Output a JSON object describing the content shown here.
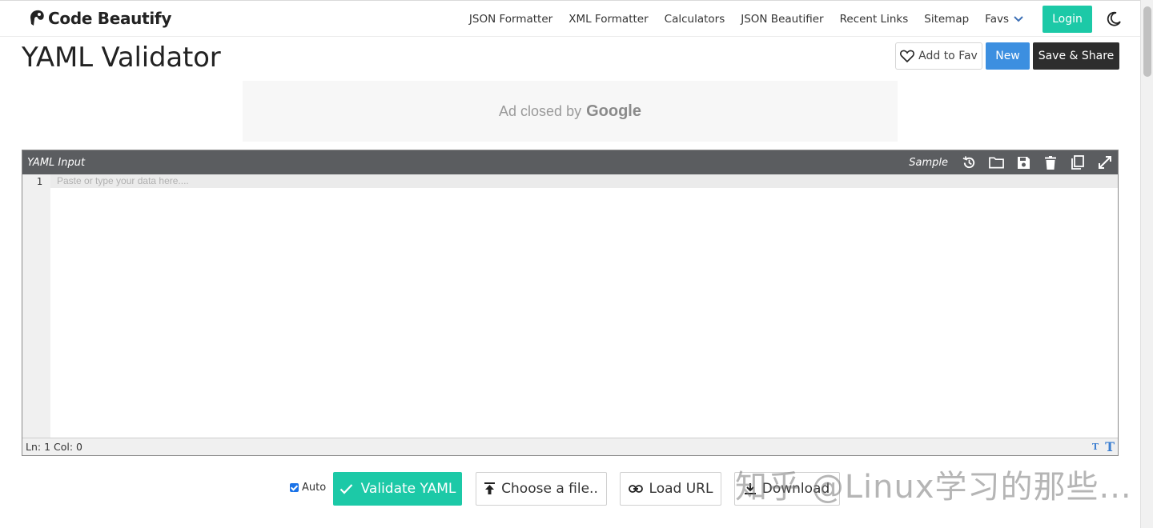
{
  "brand": {
    "name": "Code Beautify"
  },
  "nav": {
    "links": [
      "JSON Formatter",
      "XML Formatter",
      "Calculators",
      "JSON Beautifier",
      "Recent Links",
      "Sitemap"
    ],
    "favs_label": "Favs",
    "login_label": "Login"
  },
  "page": {
    "title": "YAML Validator",
    "add_fav_label": "Add to Fav",
    "new_label": "New",
    "save_share_label": "Save & Share"
  },
  "ad": {
    "text": "Ad closed by",
    "brand": "Google"
  },
  "editor": {
    "title": "YAML Input",
    "sample_label": "Sample",
    "line_number": "1",
    "placeholder": "Paste or type your data here....",
    "status": "Ln: 1 Col: 0"
  },
  "controls": {
    "auto_label": "Auto",
    "validate_label": "Validate YAML",
    "choose_file_label": "Choose a file..",
    "load_url_label": "Load URL",
    "download_label": "Download"
  },
  "watermark": "知乎 @Linux学习的那些...",
  "colors": {
    "accent": "#1cc9a7",
    "blue": "#3c8fe0",
    "dark": "#2d2d2d",
    "editor_header": "#5b5d60"
  },
  "icons": [
    "history-icon",
    "folder-icon",
    "save-icon",
    "trash-icon",
    "copy-icon",
    "expand-icon",
    "heart-icon",
    "moon-icon",
    "check-icon",
    "upload-icon",
    "link-icon",
    "download-icon"
  ]
}
